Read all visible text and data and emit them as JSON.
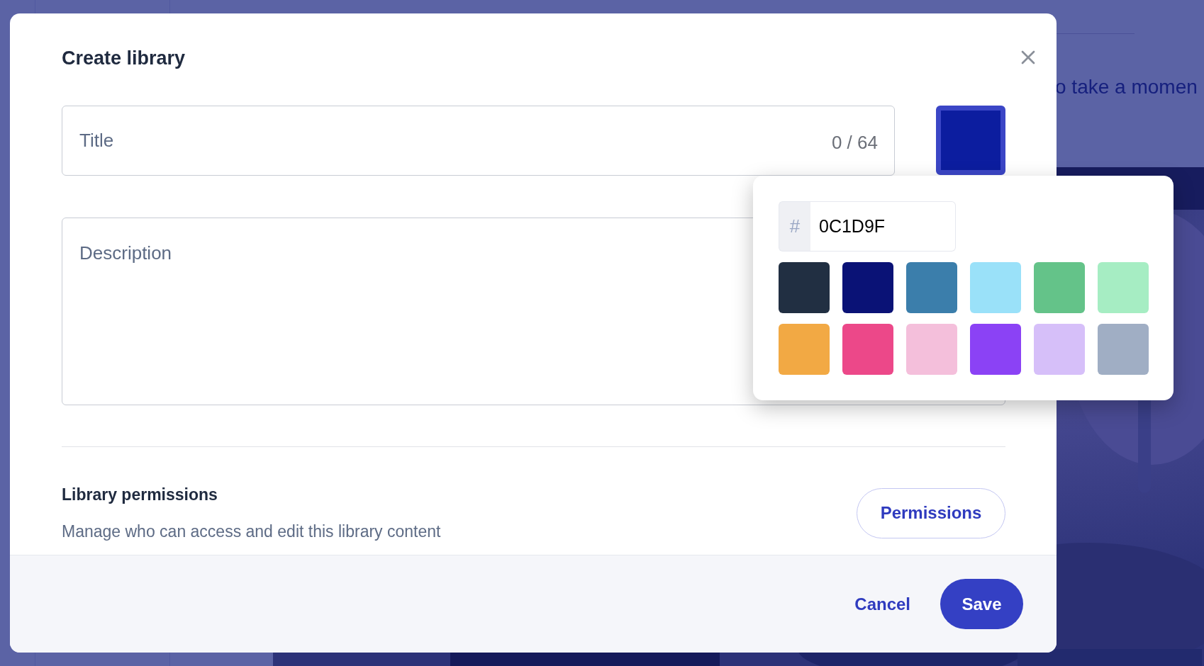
{
  "background": {
    "text": "o take a momen"
  },
  "dialog": {
    "title": "Create library",
    "title_field": {
      "placeholder": "Title",
      "counter": "0 / 64"
    },
    "color_button": {
      "color": "#0c1d9f"
    },
    "color_picker": {
      "prefix": "#",
      "value": "0C1D9F",
      "swatches": [
        {
          "color": "#212f42"
        },
        {
          "color": "#0a1276"
        },
        {
          "color": "#3b7eab"
        },
        {
          "color": "#9ae1f9"
        },
        {
          "color": "#64c389"
        },
        {
          "color": "#a6edc3"
        },
        {
          "color": "#f2a944"
        },
        {
          "color": "#ec4889"
        },
        {
          "color": "#f4bfdb"
        },
        {
          "color": "#8b42f5"
        },
        {
          "color": "#d6bff9"
        },
        {
          "color": "#a0aec4"
        }
      ]
    },
    "description_field": {
      "placeholder": "Description"
    },
    "permissions": {
      "heading": "Library permissions",
      "text": "Manage who can access and edit this library content",
      "button": "Permissions"
    },
    "footer": {
      "buttons": [
        {
          "label": "Cancel",
          "kind": "link"
        },
        {
          "label": "Save",
          "kind": "primary"
        }
      ]
    }
  }
}
